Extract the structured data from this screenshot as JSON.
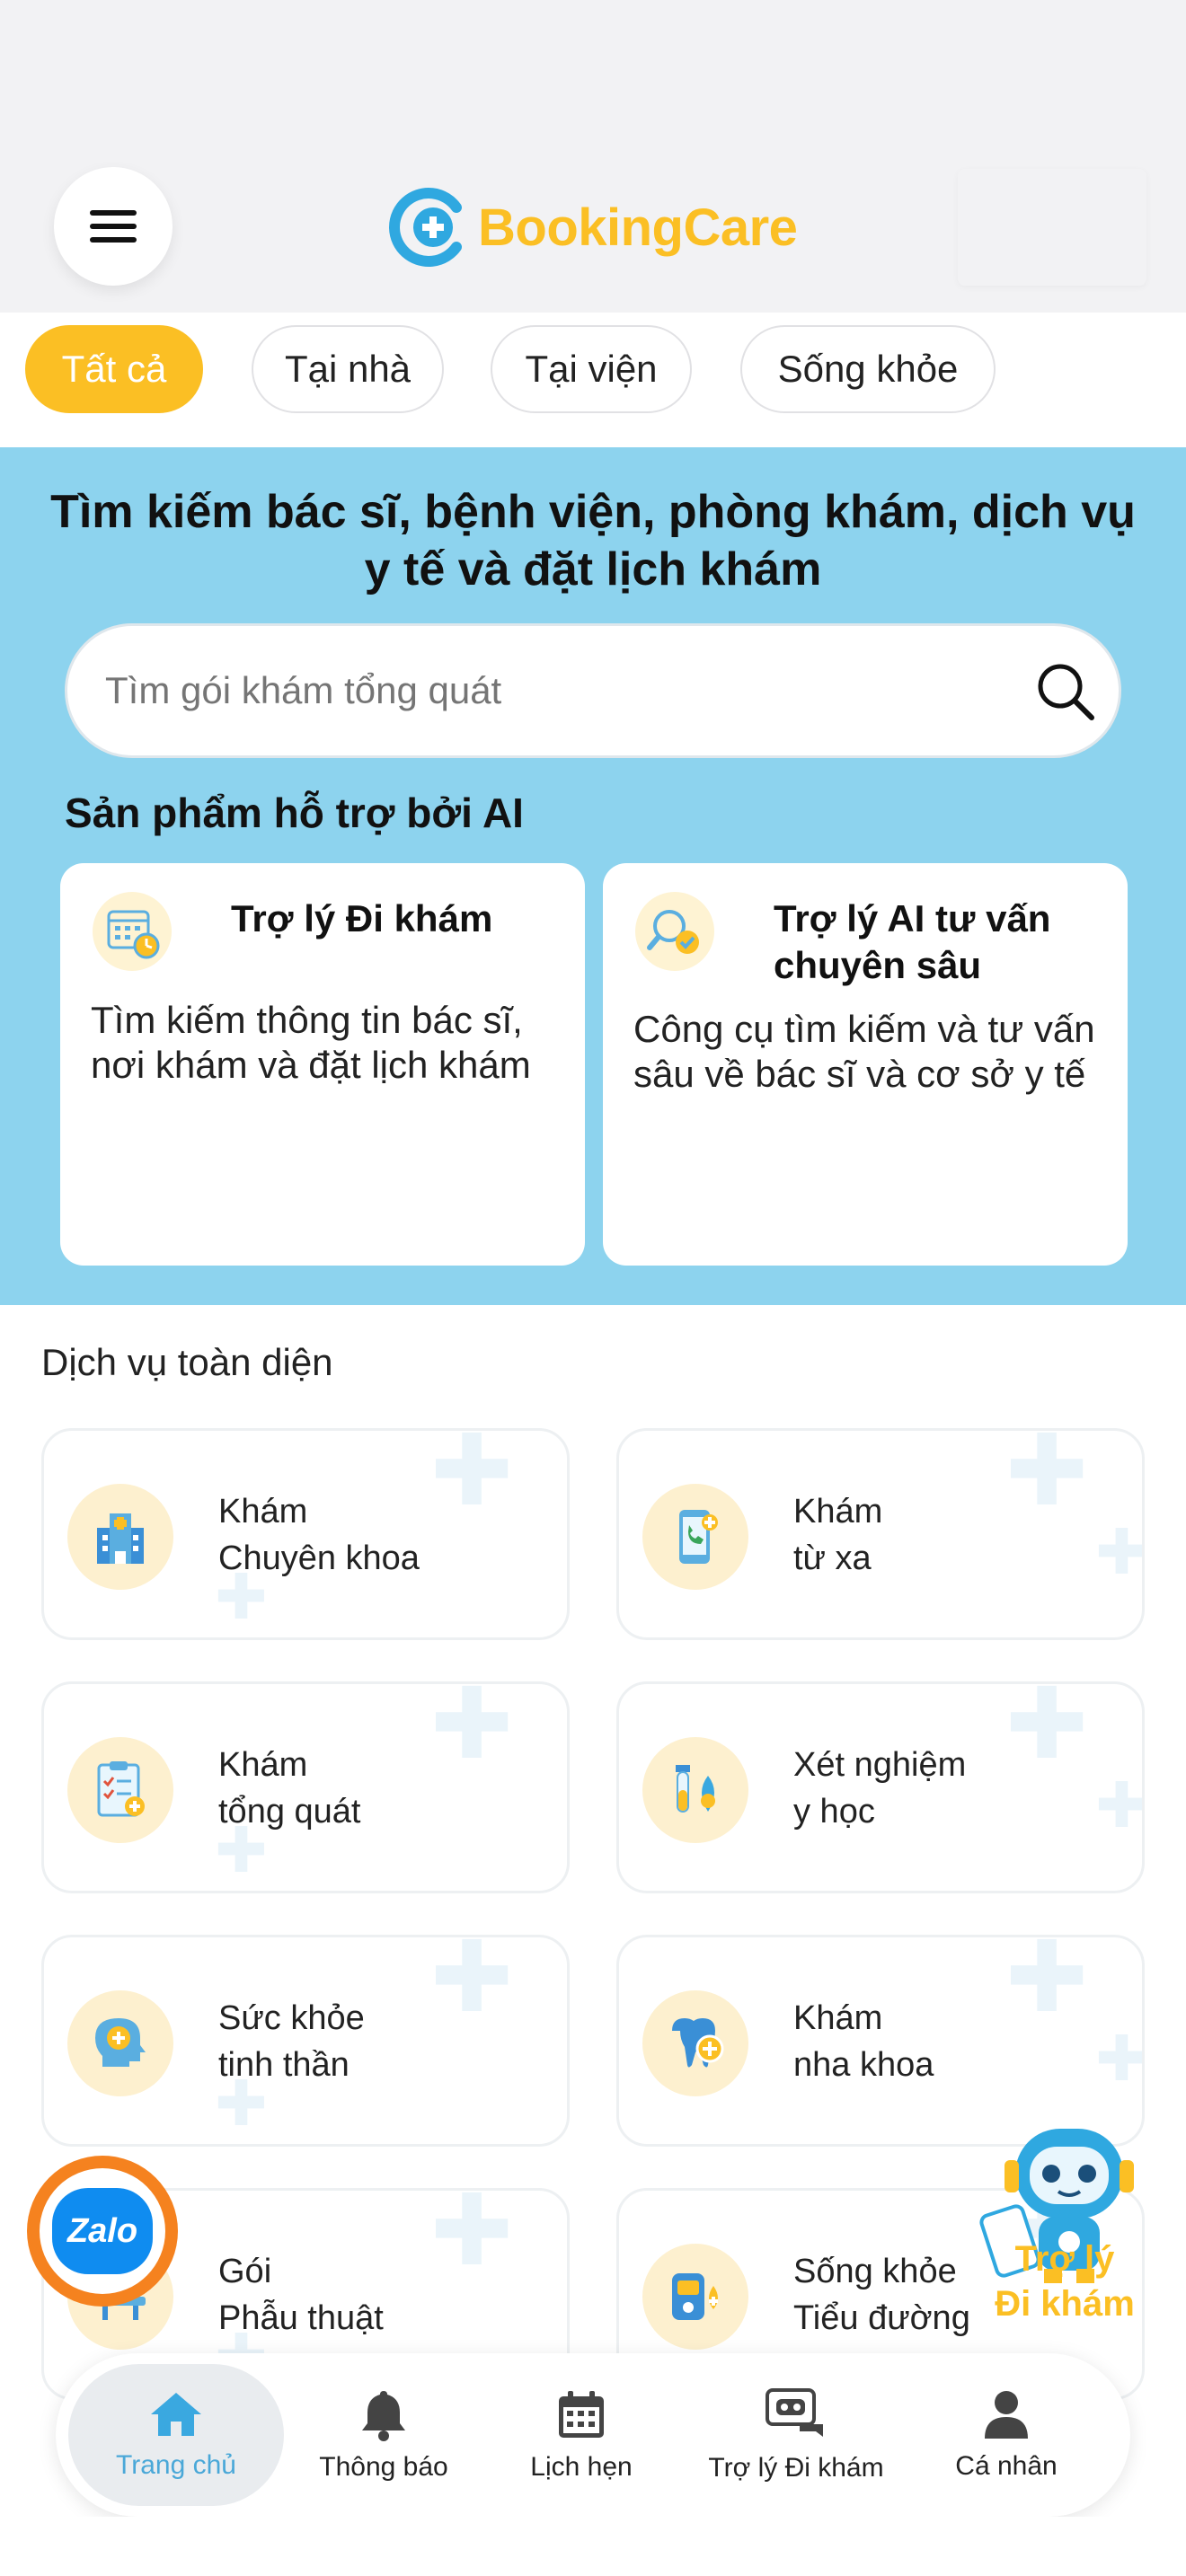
{
  "header": {
    "brand": "BookingCare",
    "colors": {
      "accent": "#fbbf24",
      "brand_blue": "#2fa8e0",
      "hero_bg": "#8dd3ee"
    }
  },
  "filters": [
    {
      "label": "Tất cả",
      "active": true
    },
    {
      "label": "Tại nhà",
      "active": false
    },
    {
      "label": "Tại viện",
      "active": false
    },
    {
      "label": "Sống khỏe",
      "active": false
    }
  ],
  "hero": {
    "title": "Tìm kiếm bác sĩ, bệnh viện, phòng khám, dịch vụ y tế và đặt lịch khám",
    "search_placeholder": "Tìm gói khám tổng quát",
    "ai_section_title": "Sản phẩm hỗ trợ bởi AI",
    "ai_cards": [
      {
        "title": "Trợ lý Đi khám",
        "desc": "Tìm kiếm thông tin bác sĩ, nơi khám và đặt lịch khám",
        "icon": "calendar-clock-icon"
      },
      {
        "title": "Trợ lý AI tư vấn chuyên sâu",
        "desc": "Công cụ tìm kiếm và tư vấn sâu về bác sĩ và cơ sở y tế",
        "icon": "search-check-icon"
      }
    ]
  },
  "services": {
    "title": "Dịch vụ toàn diện",
    "items": [
      {
        "line1": "Khám",
        "line2": "Chuyên khoa",
        "icon": "hospital-icon"
      },
      {
        "line1": "Khám",
        "line2": "từ xa",
        "icon": "phone-call-icon"
      },
      {
        "line1": "Khám",
        "line2": "tổng quát",
        "icon": "clipboard-icon"
      },
      {
        "line1": "Xét nghiệm",
        "line2": "y học",
        "icon": "test-tube-icon"
      },
      {
        "line1": "Sức khỏe",
        "line2": "tinh thần",
        "icon": "mental-health-icon"
      },
      {
        "line1": "Khám",
        "line2": "nha khoa",
        "icon": "tooth-icon"
      },
      {
        "line1": "Gói",
        "line2": "Phẫu thuật",
        "icon": "surgery-bed-icon"
      },
      {
        "line1": "Sống khỏe",
        "line2": "Tiểu đường",
        "icon": "glucose-meter-icon"
      }
    ]
  },
  "floating": {
    "zalo_label": "Zalo",
    "assistant_line1": "Trợ lý",
    "assistant_line2": "Đi khám"
  },
  "bottom_nav": [
    {
      "label": "Trang chủ",
      "icon": "home-icon",
      "active": true
    },
    {
      "label": "Thông báo",
      "icon": "bell-icon",
      "active": false
    },
    {
      "label": "Lịch hẹn",
      "icon": "calendar-icon",
      "active": false
    },
    {
      "label": "Trợ lý Đi khám",
      "icon": "robot-chat-icon",
      "active": false
    },
    {
      "label": "Cá nhân",
      "icon": "user-icon",
      "active": false
    }
  ]
}
